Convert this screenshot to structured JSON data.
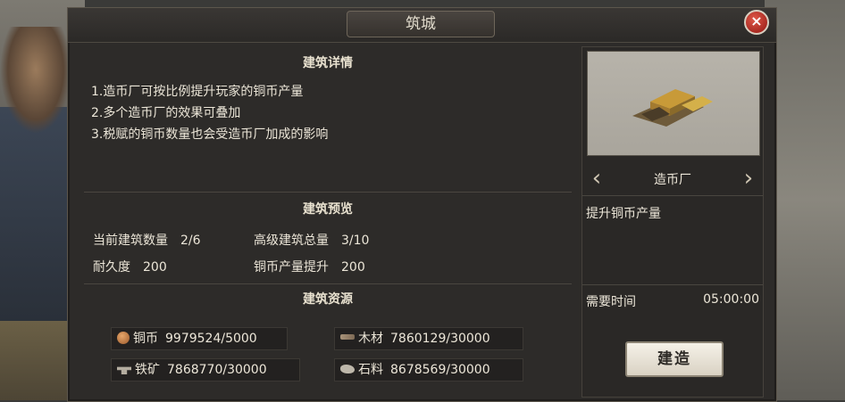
{
  "title": "筑城",
  "close_icon": "×",
  "details": {
    "heading": "建筑详情",
    "lines": [
      "1.造币厂可按比例提升玩家的铜币产量",
      "2.多个造币厂的效果可叠加",
      "3.税赋的铜币数量也会受造币厂加成的影响"
    ]
  },
  "preview": {
    "heading": "建筑预览",
    "current_count_label": "当前建筑数量",
    "current_count_value": "2/6",
    "advanced_total_label": "高级建筑总量",
    "advanced_total_value": "3/10",
    "durability_label": "耐久度",
    "durability_value": "200",
    "copper_boost_label": "铜币产量提升",
    "copper_boost_value": "200"
  },
  "resources": {
    "heading": "建筑资源",
    "items": [
      {
        "icon": "copper-coin-icon",
        "label": "铜币",
        "value": "9979524/5000"
      },
      {
        "icon": "wood-icon",
        "label": "木材",
        "value": "7860129/30000"
      },
      {
        "icon": "iron-ore-icon",
        "label": "铁矿",
        "value": "7868770/30000"
      },
      {
        "icon": "stone-icon",
        "label": "石料",
        "value": "8678569/30000"
      }
    ]
  },
  "building": {
    "name": "造币厂",
    "description": "提升铜币产量",
    "time_label": "需要时间",
    "time_value": "05:00:00",
    "build_button": "建造",
    "prev_arrow": "‹",
    "next_arrow": "›"
  },
  "colors": {
    "panel_bg": "#2d2b29",
    "text": "#ece6d8",
    "close": "#c0392b",
    "button_bg": "#efe9dc"
  }
}
